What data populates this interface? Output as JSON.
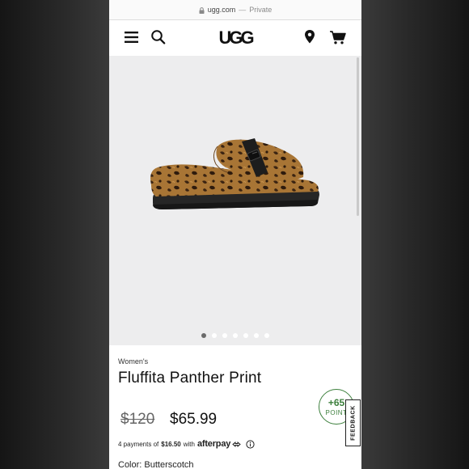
{
  "browser": {
    "domain": "ugg.com",
    "separator": "—",
    "mode": "Private"
  },
  "header": {
    "logo_text": "UGG",
    "icons": [
      "menu-icon",
      "search-icon",
      "location-pin-icon",
      "cart-icon"
    ]
  },
  "gallery": {
    "image_count": 7,
    "active_index": 0
  },
  "product": {
    "category": "Women's",
    "name": "Fluffita Panther Print",
    "original_price": "$120",
    "sale_price": "$65.99"
  },
  "afterpay": {
    "prefix": "4 payments of",
    "amount": "$16.50",
    "suffix": "with",
    "brand": "afterpay"
  },
  "color": {
    "label": "Color:",
    "value": "Butterscotch"
  },
  "rewards": {
    "points": "+65",
    "label": "POINT"
  },
  "feedback": {
    "label": "FEEDBACK"
  },
  "colors": {
    "points_green": "#3c7f3c",
    "hero_bg": "#ededee"
  }
}
